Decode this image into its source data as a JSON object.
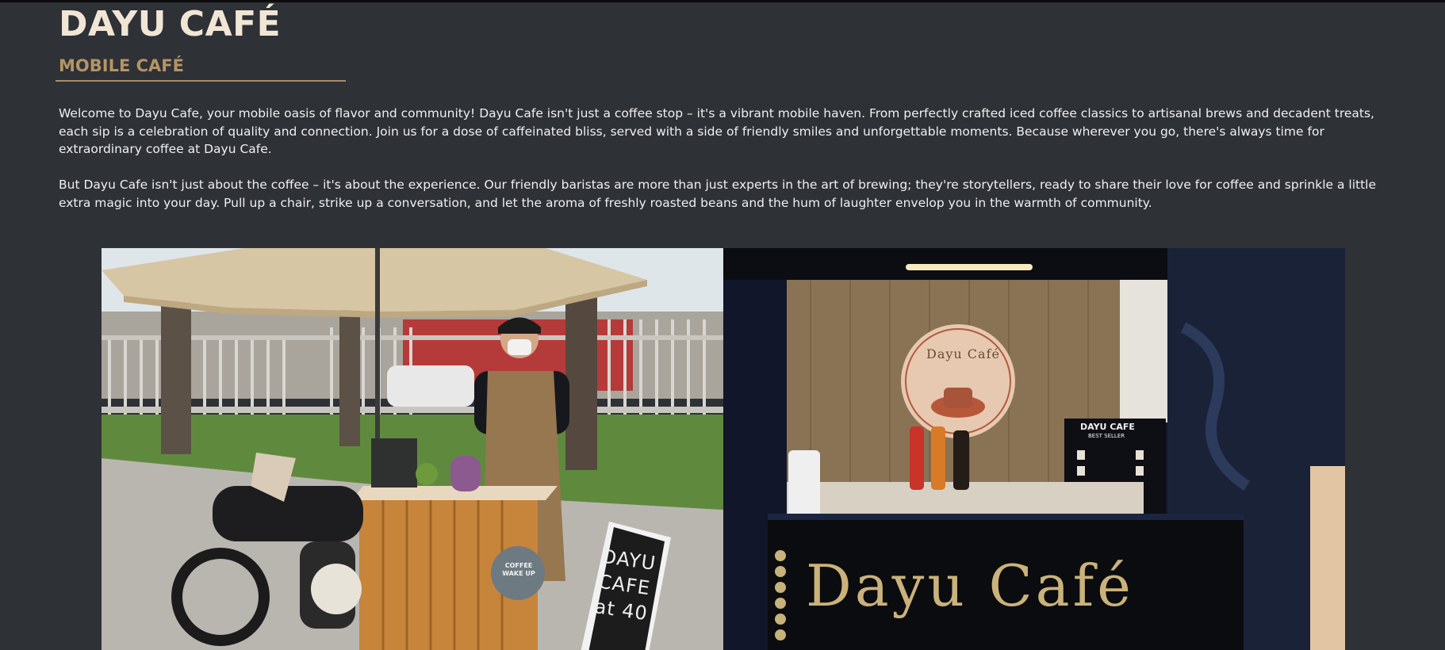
{
  "header": {
    "title": "DAYU CAFÉ",
    "subtitle": "MOBILE CAFÉ"
  },
  "intro": {
    "paragraph_1": "Welcome to Dayu Cafe, your mobile oasis of flavor and community! Dayu Cafe isn't just a coffee stop – it's a vibrant mobile haven. From perfectly crafted iced coffee classics to artisanal brews and decadent treats, each sip is a celebration of quality and connection. Join us for a dose of caffeinated bliss, served with a side of friendly smiles and unforgettable moments. Because wherever you go, there's always time for extraordinary coffee at Dayu Cafe.",
    "paragraph_2": "But Dayu Cafe isn't just about the coffee – it's about the experience. Our friendly baristas are more than just experts in the art of brewing; they're storytellers, ready to share their love for coffee and sprinkle a little extra magic into your day. Pull up a chair, strike up a conversation, and let the aroma of freshly roasted beans and the hum of laughter envelop you in the warmth of community."
  },
  "gallery": {
    "photo_1": {
      "board_text": "DAYU CAFE at 40",
      "sign_text": "COFFEE WAKE UP"
    },
    "photo_2": {
      "stall_name": "Dayu Café",
      "wall_logo_text": "Dayu Café",
      "menu_board_title": "DAYU CAFE",
      "menu_board_subtitle": "BEST SELLER"
    }
  },
  "colors": {
    "background": "#2e3136",
    "title": "#f1e6d6",
    "accent": "#b59466",
    "body_text": "#f0f0f0"
  }
}
